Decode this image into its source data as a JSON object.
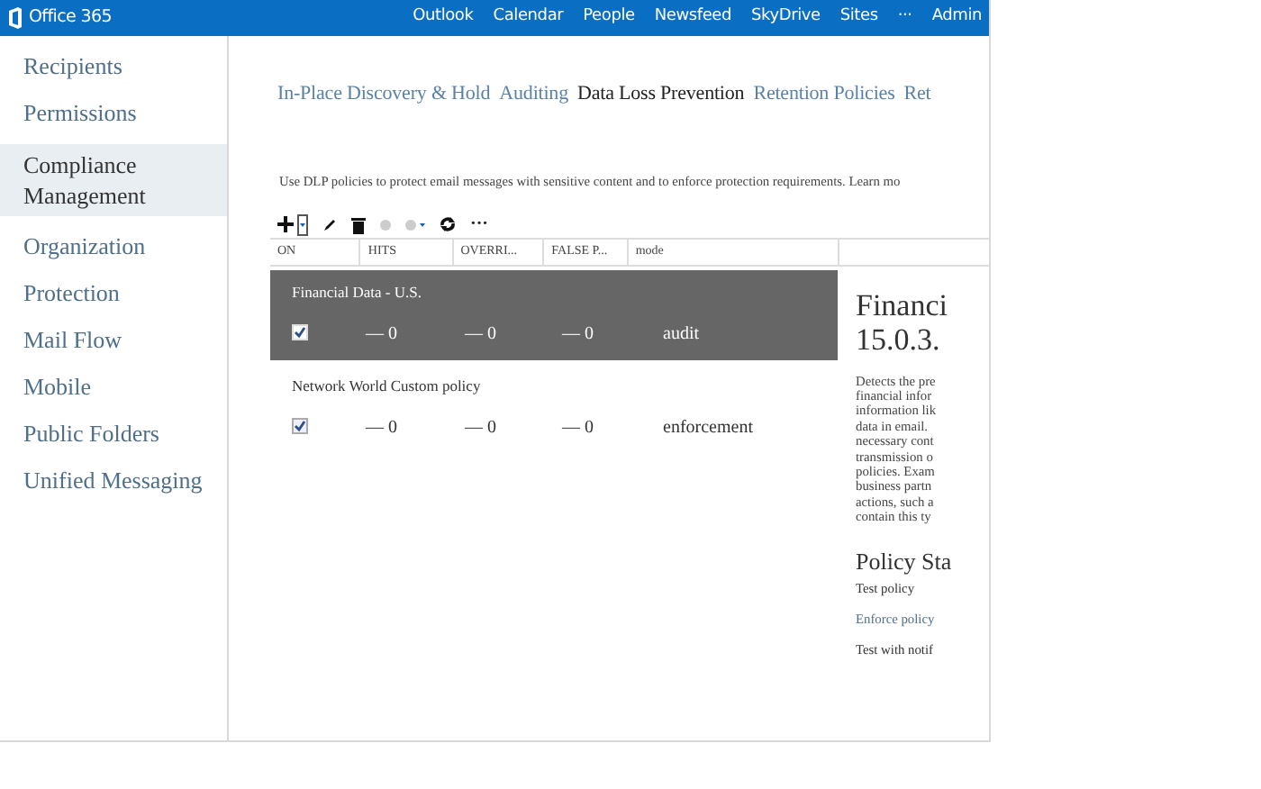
{
  "top_bar": {
    "logo_text": "Office 365",
    "links": [
      {
        "label": "Outlook"
      },
      {
        "label": "Calendar"
      },
      {
        "label": "People"
      },
      {
        "label": "Newsfeed"
      },
      {
        "label": "SkyDrive"
      },
      {
        "label": "Sites"
      },
      {
        "label": "···"
      },
      {
        "label": "Admin"
      }
    ]
  },
  "sidebar": {
    "items": [
      {
        "label": "Recipients",
        "selected": false
      },
      {
        "label": "Permissions",
        "selected": false
      },
      {
        "label": "Compliance Management",
        "selected": true
      },
      {
        "label": "Organization",
        "selected": false
      },
      {
        "label": "Protection",
        "selected": false
      },
      {
        "label": "Mail Flow",
        "selected": false
      },
      {
        "label": "Mobile",
        "selected": false
      },
      {
        "label": "Public Folders",
        "selected": false
      },
      {
        "label": "Unified Messaging",
        "selected": false
      }
    ]
  },
  "tabs": [
    {
      "label": "In-Place Discovery & Hold",
      "selected": false
    },
    {
      "label": "Auditing",
      "selected": false
    },
    {
      "label": "Data Loss Prevention",
      "selected": true
    },
    {
      "label": "Retention Policies",
      "selected": false
    },
    {
      "label": "Ret",
      "selected": false
    }
  ],
  "description": "Use DLP policies to protect email messages with sensitive content and to enforce protection requirements. Learn mo",
  "toolbar": {
    "more_label": "···"
  },
  "table": {
    "columns": [
      "ON",
      "HITS",
      "OVERRI...",
      "FALSE P...",
      "mode"
    ],
    "rows": [
      {
        "name": "Financial Data - U.S.",
        "on": true,
        "hits": "— 0",
        "overrides": "— 0",
        "false_positives": "— 0",
        "mode": "audit",
        "selected": true
      },
      {
        "name": "Network World Custom policy",
        "on": true,
        "hits": "— 0",
        "overrides": "— 0",
        "false_positives": "— 0",
        "mode": "enforcement",
        "selected": false
      }
    ]
  },
  "details": {
    "title_lines": [
      "Financi",
      "15.0.3."
    ],
    "description_lines": [
      "Detects the pre",
      "financial infor",
      "information lik",
      "data in email. ",
      "necessary cont",
      "transmission o",
      "policies. Exam",
      "business partn",
      "actions, such a",
      "contain this ty"
    ],
    "section_title": "Policy Sta",
    "options": [
      {
        "label": "Test policy",
        "kind": "text"
      },
      {
        "label": "Enforce policy",
        "kind": "link"
      },
      {
        "label": "Test with notif",
        "kind": "text"
      }
    ]
  }
}
